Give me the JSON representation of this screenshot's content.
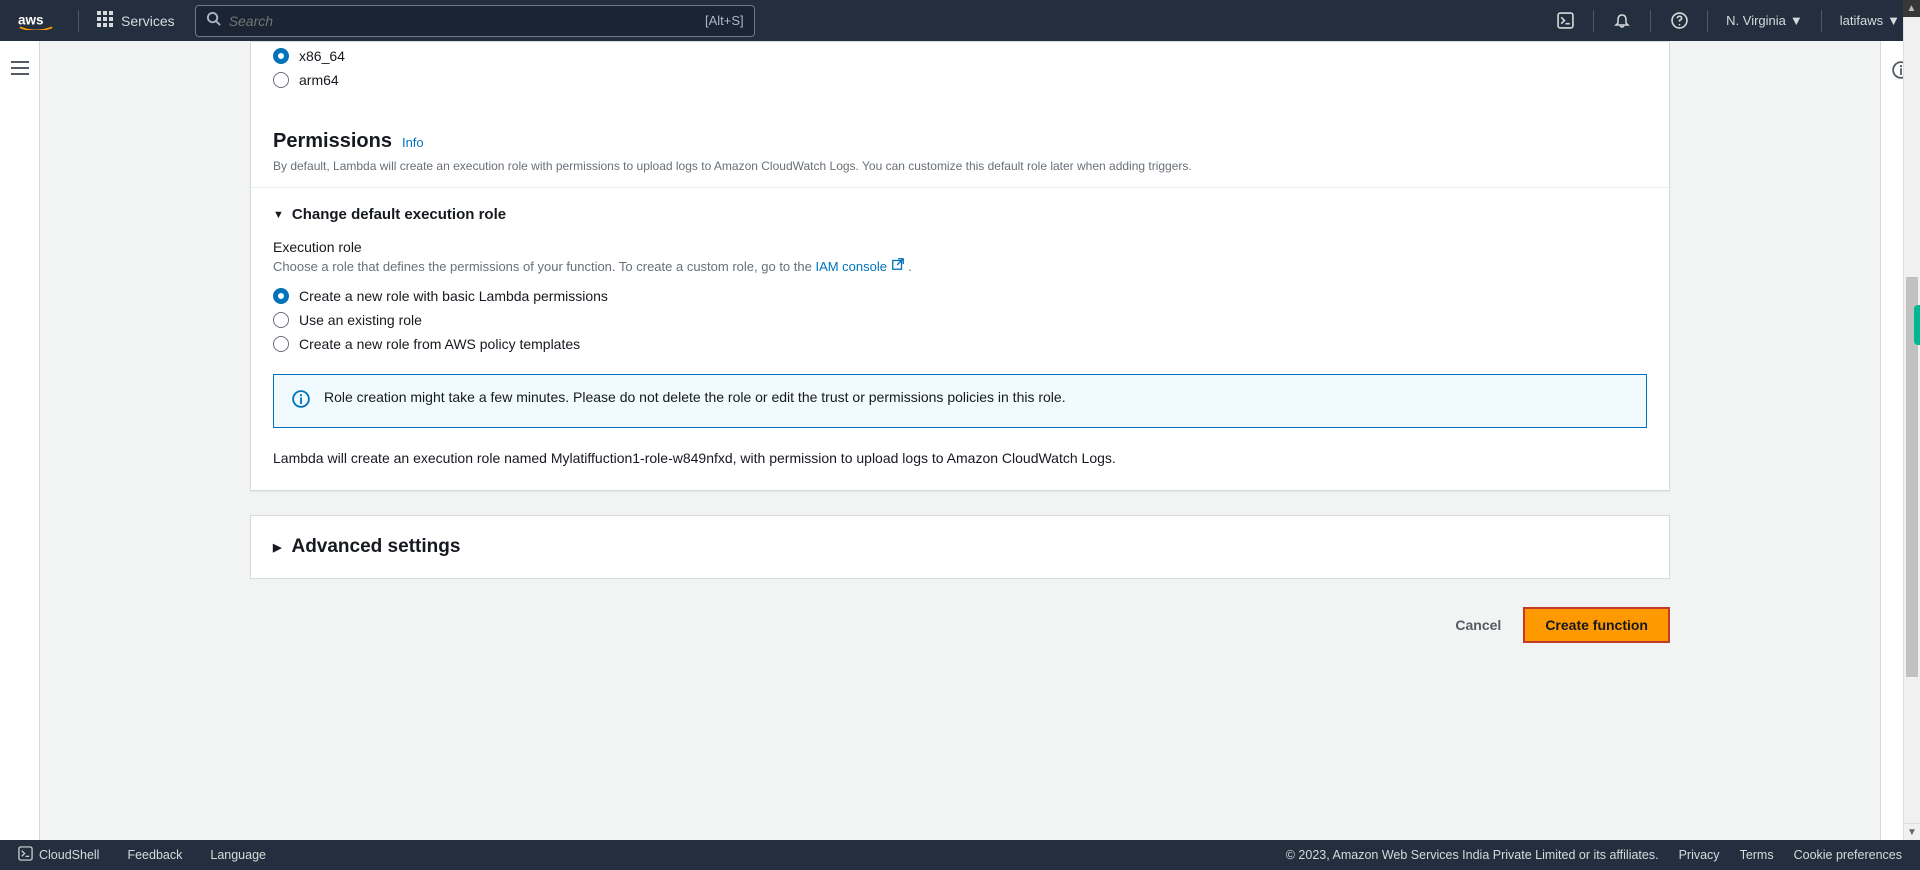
{
  "nav": {
    "services_label": "Services",
    "search_placeholder": "Search",
    "search_hint": "[Alt+S]",
    "region": "N. Virginia",
    "user": "latifaws"
  },
  "architecture": {
    "opt_x86": "x86_64",
    "opt_arm": "arm64"
  },
  "permissions": {
    "heading": "Permissions",
    "info": "Info",
    "description": "By default, Lambda will create an execution role with permissions to upload logs to Amazon CloudWatch Logs. You can customize this default role later when adding triggers."
  },
  "exec_role": {
    "expander": "Change default execution role",
    "label": "Execution role",
    "hint_pre": "Choose a role that defines the permissions of your function. To create a custom role, go to the ",
    "iam_link": "IAM console",
    "hint_post": ".",
    "opt_new_basic": "Create a new role with basic Lambda permissions",
    "opt_existing": "Use an existing role",
    "opt_template": "Create a new role from AWS policy templates",
    "alert": "Role creation might take a few minutes. Please do not delete the role or edit the trust or permissions policies in this role.",
    "summary": "Lambda will create an execution role named Mylatiffuction1-role-w849nfxd, with permission to upload logs to Amazon CloudWatch Logs."
  },
  "advanced": {
    "heading": "Advanced settings"
  },
  "actions": {
    "cancel": "Cancel",
    "create": "Create function"
  },
  "footer": {
    "cloudshell": "CloudShell",
    "feedback": "Feedback",
    "language": "Language",
    "copyright": "© 2023, Amazon Web Services India Private Limited or its affiliates.",
    "privacy": "Privacy",
    "terms": "Terms",
    "cookies": "Cookie preferences"
  }
}
